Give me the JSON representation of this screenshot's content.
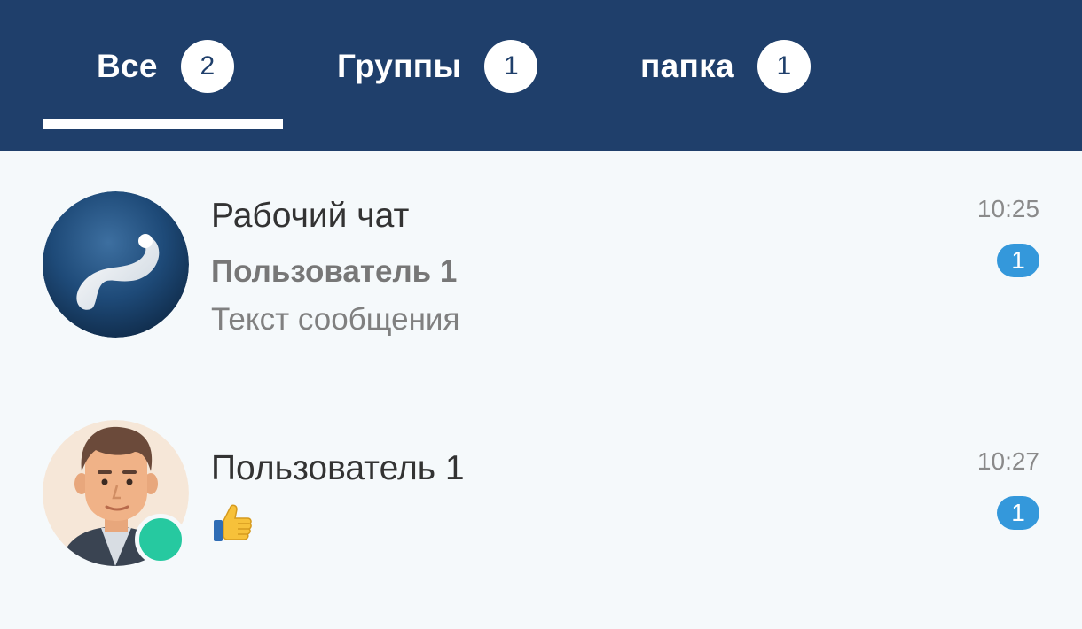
{
  "tabs": [
    {
      "label": "Все",
      "count": "2",
      "active": true
    },
    {
      "label": "Группы",
      "count": "1",
      "active": false
    },
    {
      "label": "папка",
      "count": "1",
      "active": false
    }
  ],
  "chats": [
    {
      "title": "Рабочий чат",
      "sender": "Пользователь 1",
      "preview": "Текст сообщения",
      "time": "10:25",
      "unread": "1",
      "avatar_icon": "group-logo-icon"
    },
    {
      "title": "Пользователь 1",
      "preview_icon": "thumbs-up-icon",
      "time": "10:27",
      "unread": "1",
      "avatar_icon": "user-avatar",
      "online": true
    }
  ],
  "colors": {
    "header_bg": "#1f3f6b",
    "list_bg": "#f5f9fb",
    "badge_blue": "#3498db",
    "online_green": "#26c9a0"
  }
}
